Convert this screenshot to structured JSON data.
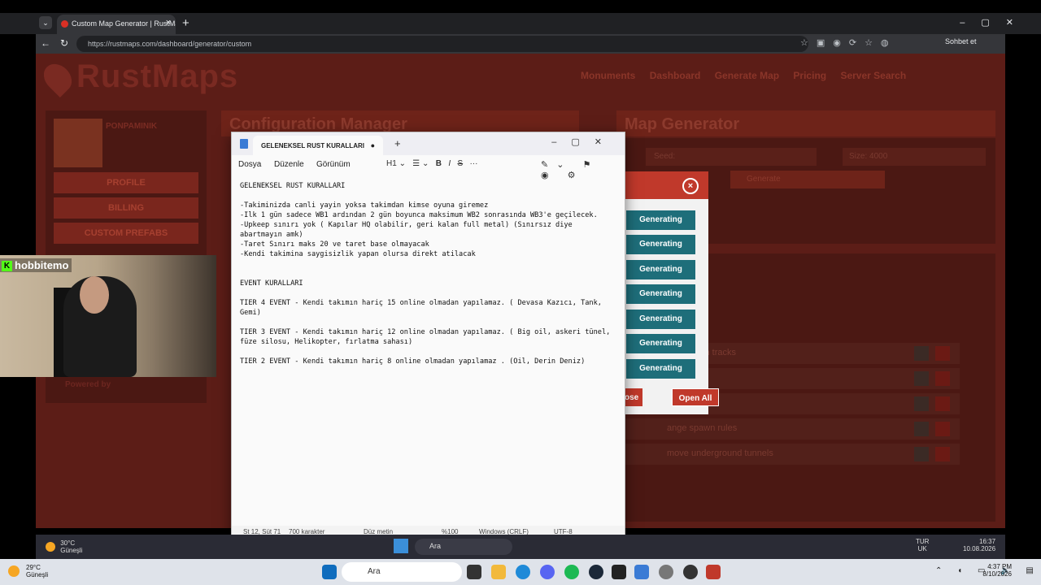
{
  "browser": {
    "tab_title": "Custom Map Generator | RustMap",
    "url": "https://rustmaps.com/dashboard/generator/custom",
    "chat_label": "Sohbet et"
  },
  "site": {
    "logo": "RustMaps",
    "nav": [
      "Monuments",
      "Dashboard",
      "Generate Map",
      "Pricing",
      "Server Search"
    ],
    "username": "PONPAMINIK",
    "sidebar_buttons": [
      "PROFILE",
      "BILLING",
      "CUSTOM PREFABS"
    ],
    "powered": "Powered by",
    "config_title": "Configuration Manager",
    "mapgen_title": "Map Generator",
    "seed_label": "Seed:",
    "size_label": "Size:",
    "size_value": "4000",
    "generate_label": "Generate",
    "options": [
      "round train tracks",
      "",
      "lines",
      "ange spawn rules",
      "move underground tunnels"
    ]
  },
  "dialog": {
    "close_icon": "×",
    "generating_label": "Generating",
    "close_label": "ose",
    "open_all_label": "Open All"
  },
  "stream": {
    "username": "hobbitemo"
  },
  "notepad": {
    "tab_title": "GELENEKSEL RUST KURALLARI",
    "menu": [
      "Dosya",
      "Düzenle",
      "Görünüm"
    ],
    "heading_select": "H1",
    "lines": [
      "GELENEKSEL RUST KURALLARI",
      "",
      "-Takiminizda canli yayin yoksa takimdan kimse oyuna giremez",
      "-Ilk 1 gün sadece WB1 ardından 2 gün boyunca maksimum WB2 sonrasında WB3'e geçilecek.",
      "-Upkeep sınırı yok ( Kapılar HQ olabilir, geri kalan full metal) (Sınırsız diye",
      "abartmayın amk)",
      "-Taret Sınırı maks 20 ve taret base olmayacak",
      "-Kendi takimina saygisizlik yapan olursa direkt atilacak",
      "",
      "",
      "EVENT KURALLARI",
      "",
      "TIER 4 EVENT - Kendi takımın hariç 15 online olmadan yapılamaz. ( Devasa Kazıcı, Tank,",
      "Gemi)",
      "",
      "TIER 3 EVENT - Kendi takımın hariç 12 online olmadan yapılamaz. ( Big oil, askeri tünel,",
      "füze silosu, Helikopter, fırlatma sahası)",
      "",
      "TIER 2 EVENT - Kendi takımın hariç 8 online olmadan yapılamaz . (Oil, Derin Deniz)"
    ],
    "status": {
      "position": "St 12, Süt 71",
      "chars": "700 karakter",
      "format": "Düz metin",
      "zoom": "%100",
      "eol": "Windows (CRLF)",
      "encoding": "UTF-8"
    }
  },
  "inner_taskbar": {
    "temp": "30°C",
    "condition": "Güneşli",
    "search": "Ara",
    "lang": "TUR",
    "region": "UK",
    "time": "16:37",
    "date": "10.08.2026"
  },
  "taskbar": {
    "temp": "29°C",
    "condition": "Güneşli",
    "search": "Ara",
    "time": "4:37 PM",
    "date": "8/10/2026"
  }
}
